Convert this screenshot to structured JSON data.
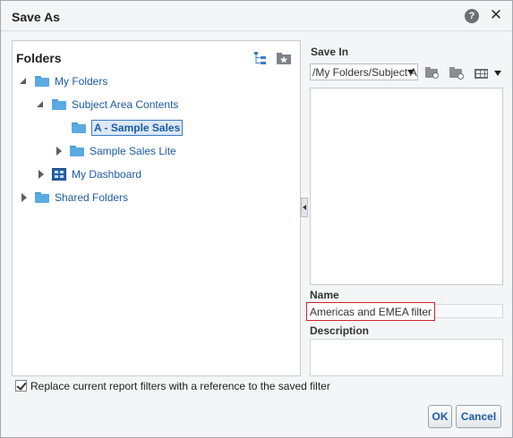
{
  "dialog": {
    "title": "Save As",
    "help_icon": "question-circle-icon",
    "close_icon": "close-icon",
    "help_glyph": "?",
    "close_glyph": "✕"
  },
  "folders": {
    "title": "Folders",
    "toolbar_icons": [
      "tree-view-icon",
      "favorites-folder-icon"
    ],
    "tree": [
      {
        "label": "My Folders",
        "state": "expanded",
        "icon": "folder-icon",
        "selected": false
      },
      {
        "label": "Subject Area Contents",
        "state": "expanded",
        "icon": "folder-icon",
        "selected": false
      },
      {
        "label": "A - Sample Sales",
        "state": "none",
        "icon": "folder-icon",
        "selected": true
      },
      {
        "label": "Sample Sales Lite",
        "state": "collapsed",
        "icon": "folder-icon",
        "selected": false
      },
      {
        "label": "My Dashboard",
        "state": "collapsed",
        "icon": "dashboard-icon",
        "selected": false
      },
      {
        "label": "Shared Folders",
        "state": "collapsed",
        "icon": "folder-icon",
        "selected": false
      }
    ]
  },
  "save_in": {
    "label": "Save In",
    "value": "/My Folders/Subject Area Contents/A - Sample Sales",
    "toolbar_icons": [
      "new-folder-icon",
      "new-folder-options-icon",
      "view-icon"
    ]
  },
  "name": {
    "label": "Name",
    "value": "Americas and EMEA filter"
  },
  "description": {
    "label": "Description",
    "value": ""
  },
  "replace_filter": {
    "label": "Replace current report filters with a reference to the saved filter",
    "checked": true
  },
  "buttons": {
    "ok": "OK",
    "cancel": "Cancel"
  },
  "colors": {
    "link": "#1d5ba4",
    "selection_border": "#3a7bc8",
    "name_field_highlight": "#d0232a"
  }
}
